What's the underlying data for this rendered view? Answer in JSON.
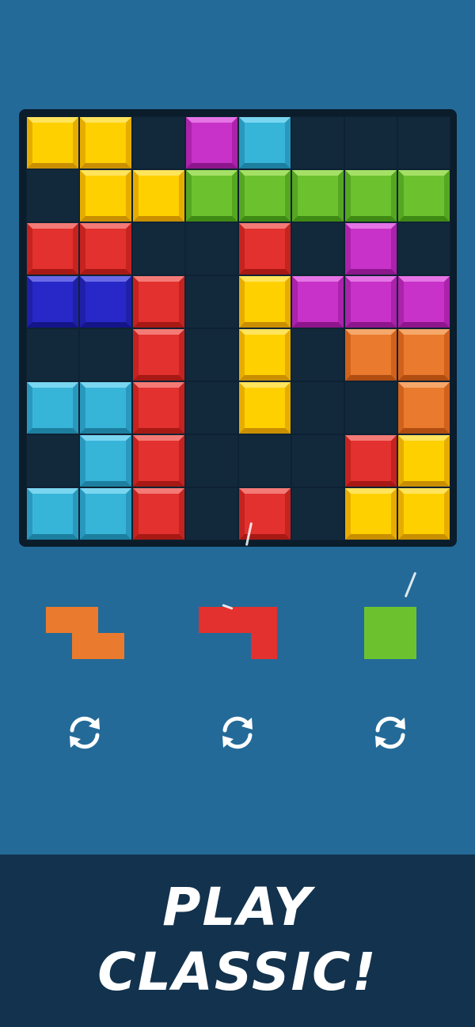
{
  "colors": {
    "Y": {
      "face": "#ffd000",
      "light": "#ffe45c",
      "dark": "#c98f00",
      "side": "#e6ad00"
    },
    "P": {
      "face": "#c832c8",
      "light": "#e574e5",
      "dark": "#8d168d",
      "side": "#ab22ab"
    },
    "C": {
      "face": "#36b5d9",
      "light": "#7ad6f0",
      "dark": "#1d7fa0",
      "side": "#2a98bd"
    },
    "G": {
      "face": "#6cc22e",
      "light": "#a4e066",
      "dark": "#3f8a14",
      "side": "#55a621"
    },
    "R": {
      "face": "#e2312e",
      "light": "#f47a76",
      "dark": "#a71914",
      "side": "#c52320"
    },
    "B": {
      "face": "#2828c8",
      "light": "#6a6ae8",
      "dark": "#15158a",
      "side": "#1f1fa8"
    },
    "O": {
      "face": "#ea7a2e",
      "light": "#f5a86a",
      "dark": "#b04d10",
      "side": "#d0621c"
    }
  },
  "board": [
    [
      "Y",
      "Y",
      ".",
      "P",
      "C",
      ".",
      ".",
      "."
    ],
    [
      ".",
      "Y",
      "Y",
      "G",
      "G",
      "G",
      "G",
      "G"
    ],
    [
      "R",
      "R",
      ".",
      ".",
      "R",
      ".",
      "P",
      "."
    ],
    [
      "B",
      "B",
      "R",
      ".",
      "Y",
      "P",
      "P",
      "P"
    ],
    [
      ".",
      ".",
      "R",
      ".",
      "Y",
      ".",
      "O",
      "O"
    ],
    [
      "C",
      "C",
      "R",
      ".",
      "Y",
      ".",
      ".",
      "O"
    ],
    [
      ".",
      "C",
      "R",
      ".",
      ".",
      ".",
      "R",
      "Y"
    ],
    [
      "C",
      "C",
      "R",
      ".",
      "R",
      ".",
      "Y",
      "Y"
    ]
  ],
  "tray_pieces": [
    {
      "name": "orange-z-piece",
      "color": "O",
      "cells": [
        [
          0,
          0
        ],
        [
          0,
          1
        ],
        [
          1,
          1
        ],
        [
          1,
          2
        ]
      ]
    },
    {
      "name": "red-l-piece",
      "color": "R",
      "cells": [
        [
          0,
          0
        ],
        [
          0,
          1
        ],
        [
          0,
          2
        ],
        [
          1,
          2
        ]
      ]
    },
    {
      "name": "green-square-piece",
      "color": "G",
      "cells": [
        [
          0,
          0
        ],
        [
          0,
          1
        ],
        [
          1,
          0
        ],
        [
          1,
          1
        ]
      ]
    }
  ],
  "rotate_icon": "rotate-arrows-icon",
  "footer": {
    "line1": "PLAY",
    "line2": "CLASSIC!"
  }
}
